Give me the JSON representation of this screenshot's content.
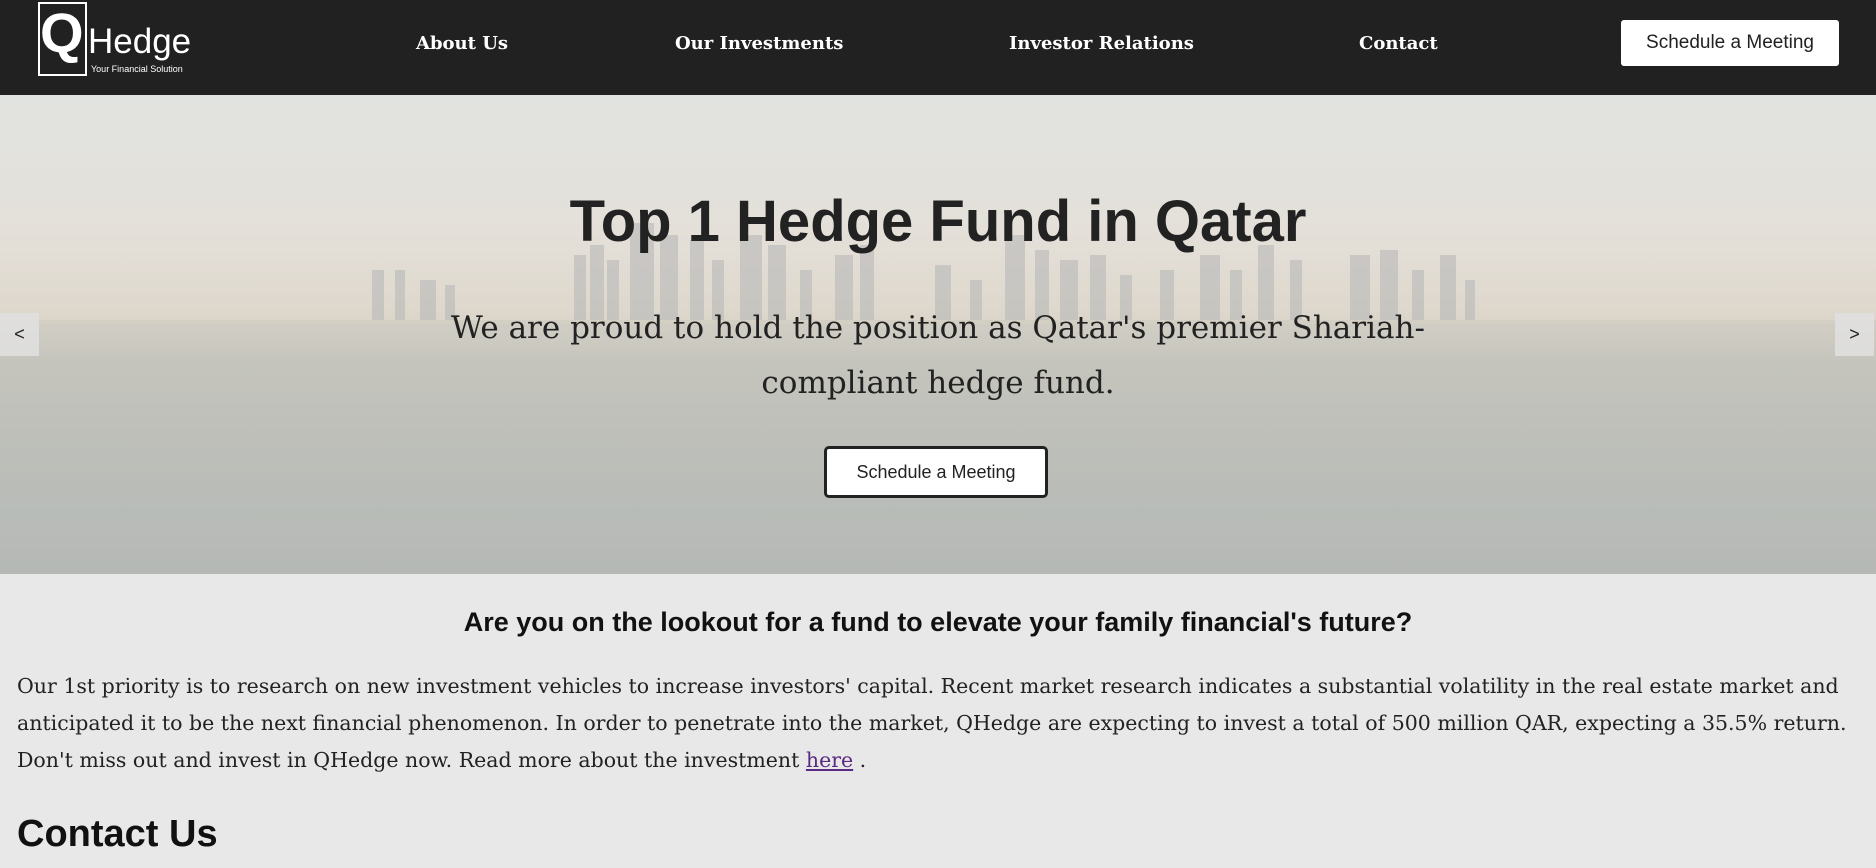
{
  "brand": {
    "logo_letter": "Q",
    "logo_word": "Hedge",
    "tagline": "Your Financial Solution"
  },
  "nav": {
    "links": [
      "About Us",
      "Our Investments",
      "Investor Relations",
      "Contact"
    ],
    "cta": "Schedule a Meeting"
  },
  "hero": {
    "title": "Top 1 Hedge Fund in Qatar",
    "subtitle": "We are proud to hold the position as Qatar's premier Shariah-compliant hedge fund.",
    "cta": "Schedule a Meeting",
    "prev": "<",
    "next": ">"
  },
  "intro": {
    "heading": "Are you on the lookout for a fund to elevate your family financial's future?",
    "body": "Our 1st priority is to research on new investment vehicles to increase investors' capital. Recent market research indicates a substantial volatility in the real estate market and anticipated it to be the next financial phenomenon. In order to penetrate into the market, QHedge are expecting to invest a total of 500 million QAR, expecting a 35.5% return. Don't miss out and invest in QHedge now. Read more about the investment",
    "link_text": "here",
    "after_link": " ."
  },
  "contact": {
    "heading": "Contact Us"
  },
  "colors": {
    "nav_bg": "#212121",
    "page_bg": "#e8e8e8",
    "link": "#5a2a82"
  }
}
